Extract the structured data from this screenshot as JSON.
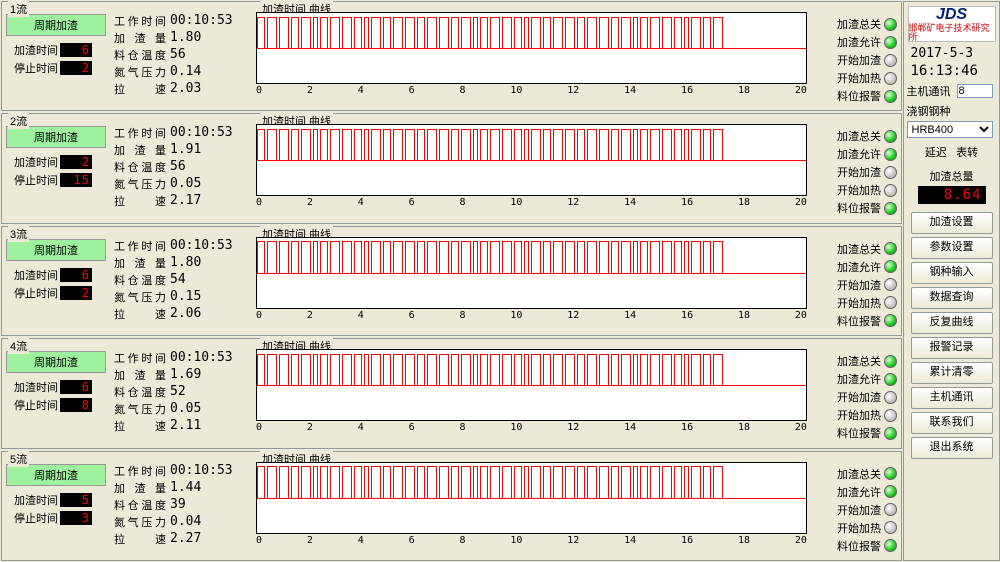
{
  "colors": {
    "accent_green": "#1cc81c",
    "lcd_red": "#ff0000"
  },
  "chart_data": [
    {
      "type": "line",
      "title": "加渣时间 曲线",
      "xlim": [
        0,
        20
      ],
      "xtick": 2,
      "active_end": 11.3,
      "pulse_fraction": 0.55
    },
    {
      "type": "line",
      "title": "加渣时间 曲线",
      "xlim": [
        0,
        20
      ],
      "xtick": 2,
      "active_end": 11.3,
      "pulse_fraction": 0.55
    },
    {
      "type": "line",
      "title": "加渣时间 曲线",
      "xlim": [
        0,
        20
      ],
      "xtick": 2,
      "active_end": 11.3,
      "pulse_fraction": 0.55
    },
    {
      "type": "line",
      "title": "加渣时间 曲线",
      "xlim": [
        0,
        20
      ],
      "xtick": 2,
      "active_end": 11.3,
      "pulse_fraction": 0.55
    },
    {
      "type": "line",
      "title": "加渣时间 曲线",
      "xlim": [
        0,
        20
      ],
      "xtick": 2,
      "active_end": 11.3,
      "pulse_fraction": 0.55
    }
  ],
  "channels": [
    {
      "title": "1流",
      "cycle_btn": "周期加渣",
      "add_time_label": "加渣时间",
      "add_time": "6",
      "stop_time_label": "停止时间",
      "stop_time": "2",
      "stats": [
        [
          "工作时间",
          "00:10:53"
        ],
        [
          "加 渣 量",
          "1.80"
        ],
        [
          "料仓温度",
          "56"
        ],
        [
          "氮气压力",
          "0.14"
        ],
        [
          "拉    速",
          "2.03"
        ]
      ],
      "chart_title": "加渣时间 曲线",
      "lights": [
        [
          "加渣总关",
          true
        ],
        [
          "加渣允许",
          true
        ],
        [
          "开始加渣",
          false
        ],
        [
          "开始加热",
          false
        ],
        [
          "料位报警",
          true
        ]
      ]
    },
    {
      "title": "2流",
      "cycle_btn": "周期加渣",
      "add_time_label": "加渣时间",
      "add_time": "2",
      "stop_time_label": "停止时间",
      "stop_time": "15",
      "stats": [
        [
          "工作时间",
          "00:10:53"
        ],
        [
          "加 渣 量",
          "1.91"
        ],
        [
          "料仓温度",
          "56"
        ],
        [
          "氮气压力",
          "0.05"
        ],
        [
          "拉    速",
          "2.17"
        ]
      ],
      "chart_title": "加渣时间 曲线",
      "lights": [
        [
          "加渣总关",
          true
        ],
        [
          "加渣允许",
          true
        ],
        [
          "开始加渣",
          false
        ],
        [
          "开始加热",
          false
        ],
        [
          "料位报警",
          true
        ]
      ]
    },
    {
      "title": "3流",
      "cycle_btn": "周期加渣",
      "add_time_label": "加渣时间",
      "add_time": "6",
      "stop_time_label": "停止时间",
      "stop_time": "2",
      "stats": [
        [
          "工作时间",
          "00:10:53"
        ],
        [
          "加 渣 量",
          "1.80"
        ],
        [
          "料仓温度",
          "54"
        ],
        [
          "氮气压力",
          "0.15"
        ],
        [
          "拉    速",
          "2.06"
        ]
      ],
      "chart_title": "加渣时间 曲线",
      "lights": [
        [
          "加渣总关",
          true
        ],
        [
          "加渣允许",
          true
        ],
        [
          "开始加渣",
          false
        ],
        [
          "开始加热",
          false
        ],
        [
          "料位报警",
          true
        ]
      ]
    },
    {
      "title": "4流",
      "cycle_btn": "周期加渣",
      "add_time_label": "加渣时间",
      "add_time": "6",
      "stop_time_label": "停止时间",
      "stop_time": "8",
      "stats": [
        [
          "工作时间",
          "00:10:53"
        ],
        [
          "加 渣 量",
          "1.69"
        ],
        [
          "料仓温度",
          "52"
        ],
        [
          "氮气压力",
          "0.05"
        ],
        [
          "拉    速",
          "2.11"
        ]
      ],
      "chart_title": "加渣时间 曲线",
      "lights": [
        [
          "加渣总关",
          true
        ],
        [
          "加渣允许",
          true
        ],
        [
          "开始加渣",
          false
        ],
        [
          "开始加热",
          false
        ],
        [
          "料位报警",
          true
        ]
      ]
    },
    {
      "title": "5流",
      "cycle_btn": "周期加渣",
      "add_time_label": "加渣时间",
      "add_time": "5",
      "stop_time_label": "停止时间",
      "stop_time": "3",
      "stats": [
        [
          "工作时间",
          "00:10:53"
        ],
        [
          "加 渣 量",
          "1.44"
        ],
        [
          "料仓温度",
          "39"
        ],
        [
          "氮气压力",
          "0.04"
        ],
        [
          "拉    速",
          "2.27"
        ]
      ],
      "chart_title": "加渣时间 曲线",
      "lights": [
        [
          "加渣总关",
          true
        ],
        [
          "加渣允许",
          true
        ],
        [
          "开始加渣",
          false
        ],
        [
          "开始加热",
          false
        ],
        [
          "料位报警",
          true
        ]
      ]
    }
  ],
  "sidebar": {
    "logo_text": "JDS",
    "logo_sub": "邯郸矿电子技术研究所",
    "date": "2017-5-3",
    "time": "16:13:46",
    "host_label": "主机通讯",
    "host_value": "8",
    "grade_label": "浇钢钢种",
    "grade_value": "HRB400",
    "link_prev": "延迟",
    "link_next": "表转",
    "total_label": "加渣总量",
    "total_value": "8.64",
    "buttons": [
      "加渣设置",
      "参数设置",
      "钢种输入",
      "数据查询",
      "反复曲线",
      "报警记录",
      "累计清零",
      "主机通讯",
      "联系我们",
      "退出系统"
    ]
  }
}
